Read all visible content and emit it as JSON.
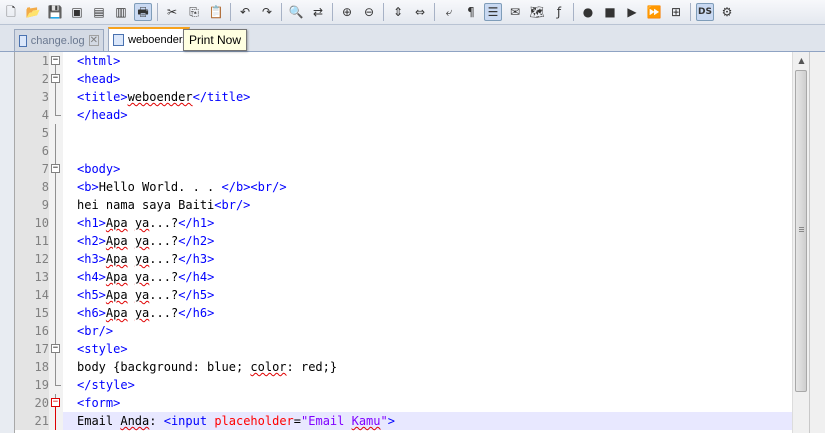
{
  "toolbar": {
    "icons": [
      {
        "name": "new-file-icon",
        "glyph": "🗋"
      },
      {
        "name": "open-file-icon",
        "glyph": "📂"
      },
      {
        "name": "save-icon",
        "glyph": "💾"
      },
      {
        "name": "save-all-icon",
        "glyph": "▣"
      },
      {
        "name": "close-icon",
        "glyph": "▤"
      },
      {
        "name": "close-all-icon",
        "glyph": "▥"
      },
      {
        "name": "print-icon",
        "glyph": "🖶",
        "active": true
      },
      {
        "sep": true
      },
      {
        "name": "cut-icon",
        "glyph": "✂"
      },
      {
        "name": "copy-icon",
        "glyph": "⎘"
      },
      {
        "name": "paste-icon",
        "glyph": "📋"
      },
      {
        "sep": true
      },
      {
        "name": "undo-icon",
        "glyph": "↶"
      },
      {
        "name": "redo-icon",
        "glyph": "↷"
      },
      {
        "sep": true
      },
      {
        "name": "find-icon",
        "glyph": "🔍"
      },
      {
        "name": "replace-icon",
        "glyph": "⇄"
      },
      {
        "sep": true
      },
      {
        "name": "zoom-in-icon",
        "glyph": "⊕"
      },
      {
        "name": "zoom-out-icon",
        "glyph": "⊖"
      },
      {
        "sep": true
      },
      {
        "name": "sync-vertical-icon",
        "glyph": "⇕"
      },
      {
        "name": "sync-horizontal-icon",
        "glyph": "⇔"
      },
      {
        "sep": true
      },
      {
        "name": "word-wrap-icon",
        "glyph": "⤶"
      },
      {
        "name": "show-all-characters-icon",
        "glyph": "¶"
      },
      {
        "name": "indent-guide-icon",
        "glyph": "☰",
        "active": true
      },
      {
        "name": "user-language-icon",
        "glyph": "✉"
      },
      {
        "name": "document-map-icon",
        "glyph": "🗺"
      },
      {
        "name": "function-list-icon",
        "glyph": "ƒ"
      },
      {
        "sep": true
      },
      {
        "name": "record-macro-icon",
        "glyph": "●"
      },
      {
        "name": "stop-macro-icon",
        "glyph": "■"
      },
      {
        "name": "play-macro-icon",
        "glyph": "▶"
      },
      {
        "name": "run-macro-multiple-icon",
        "glyph": "⏩"
      },
      {
        "name": "save-macro-icon",
        "glyph": "⊞"
      },
      {
        "sep": true
      },
      {
        "name": "ds-plugin-icon",
        "glyph": "DS",
        "active": true
      },
      {
        "name": "plugin-icon",
        "glyph": "⚙"
      }
    ]
  },
  "tabs": [
    {
      "label": "change.log",
      "close": "✕",
      "active": false
    },
    {
      "label": "weboender.",
      "active": true
    }
  ],
  "tooltip": "Print Now",
  "editor": {
    "lines": [
      {
        "n": "1",
        "fold": "minus",
        "html": "<span class=\"t\">&lt;html&gt;</span>"
      },
      {
        "n": "2",
        "fold": "minus",
        "html": "<span class=\"t\">&lt;head&gt;</span>"
      },
      {
        "n": "3",
        "fold": "line",
        "html": "<span class=\"t\">&lt;title&gt;</span><span class=\"sp\">weboender</span><span class=\"t\">&lt;/title&gt;</span>"
      },
      {
        "n": "4",
        "fold": "end",
        "html": "<span class=\"t\">&lt;/head&gt;</span>"
      },
      {
        "n": "5",
        "fold": "line",
        "html": ""
      },
      {
        "n": "6",
        "fold": "line",
        "html": ""
      },
      {
        "n": "7",
        "fold": "minus",
        "html": "<span class=\"t\">&lt;body&gt;</span>"
      },
      {
        "n": "8",
        "fold": "line",
        "html": "<span class=\"t\">&lt;b&gt;</span>Hello World. . . <span class=\"t\">&lt;/b&gt;&lt;br/&gt;</span>"
      },
      {
        "n": "9",
        "fold": "line",
        "html": "hei nama saya Baiti<span class=\"t\">&lt;br/&gt;</span>"
      },
      {
        "n": "10",
        "fold": "line",
        "html": "<span class=\"t\">&lt;h1&gt;</span><span class=\"sp\">Apa</span> <span class=\"sp\">ya</span>...?<span class=\"t\">&lt;/h1&gt;</span>"
      },
      {
        "n": "11",
        "fold": "line",
        "html": "<span class=\"t\">&lt;h2&gt;</span><span class=\"sp\">Apa</span> <span class=\"sp\">ya</span>...?<span class=\"t\">&lt;/h2&gt;</span>"
      },
      {
        "n": "12",
        "fold": "line",
        "html": "<span class=\"t\">&lt;h3&gt;</span><span class=\"sp\">Apa</span> <span class=\"sp\">ya</span>...?<span class=\"t\">&lt;/h3&gt;</span>"
      },
      {
        "n": "13",
        "fold": "line",
        "html": "<span class=\"t\">&lt;h4&gt;</span><span class=\"sp\">Apa</span> <span class=\"sp\">ya</span>...?<span class=\"t\">&lt;/h4&gt;</span>"
      },
      {
        "n": "14",
        "fold": "line",
        "html": "<span class=\"t\">&lt;h5&gt;</span><span class=\"sp\">Apa</span> <span class=\"sp\">ya</span>...?<span class=\"t\">&lt;/h5&gt;</span>"
      },
      {
        "n": "15",
        "fold": "line",
        "html": "<span class=\"t\">&lt;h6&gt;</span><span class=\"sp\">Apa</span> <span class=\"sp\">ya</span>...?<span class=\"t\">&lt;/h6&gt;</span>"
      },
      {
        "n": "16",
        "fold": "line",
        "html": "<span class=\"t\">&lt;br/&gt;</span>"
      },
      {
        "n": "17",
        "fold": "minus",
        "html": "<span class=\"t\">&lt;style&gt;</span>"
      },
      {
        "n": "18",
        "fold": "line",
        "html": "body {background: blue; <span class=\"sp\">color</span>: red;}"
      },
      {
        "n": "19",
        "fold": "end",
        "html": "<span class=\"t\">&lt;/style&gt;</span>"
      },
      {
        "n": "20",
        "fold": "minus-red",
        "html": "<span class=\"t\">&lt;form&gt;</span>"
      },
      {
        "n": "21",
        "fold": "line-red",
        "current": true,
        "html": "Email <span class=\"sp\">Anda</span>: <span class=\"t\">&lt;input</span> <span class=\"a\">placeholder</span>=<span class=\"s\">\"Email <span class=\"sp\">Kamu</span>\"</span><span class=\"t\">&gt;</span>"
      }
    ]
  },
  "colors": {
    "tag": "#0000ff",
    "attribute": "#ff0000",
    "string": "#8000ff",
    "current_line": "#e8e8ff"
  }
}
